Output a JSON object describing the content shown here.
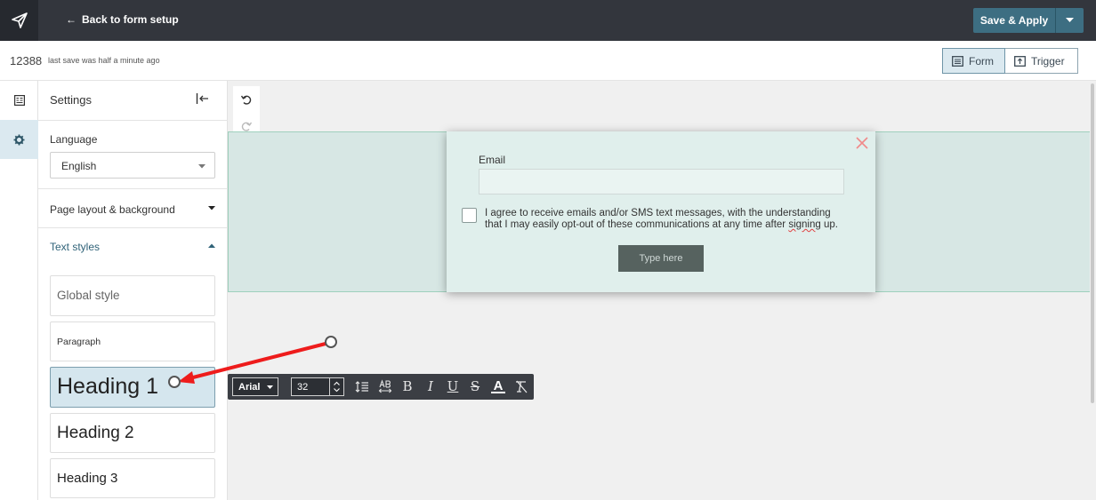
{
  "topbar": {
    "back_label": "Back to form setup",
    "save_label": "Save & Apply"
  },
  "subbar": {
    "form_id": "12388",
    "save_status": "last save was half a minute ago",
    "tabs": [
      {
        "label": "Form",
        "icon": "form-icon",
        "active": true
      },
      {
        "label": "Trigger",
        "icon": "trigger-icon",
        "active": false
      }
    ]
  },
  "rail": {
    "items": [
      {
        "icon": "form-list-icon",
        "active": false
      },
      {
        "icon": "gear-icon",
        "active": true
      }
    ]
  },
  "settings": {
    "title": "Settings",
    "language_label": "Language",
    "language_value": "English",
    "sections": [
      {
        "label": "Page layout & background",
        "expanded": false
      },
      {
        "label": "Text styles",
        "expanded": true
      }
    ],
    "text_styles": [
      {
        "label": "Global style",
        "selected": false
      },
      {
        "label": "Paragraph",
        "selected": false
      },
      {
        "label": "Heading 1",
        "selected": true
      },
      {
        "label": "Heading 2",
        "selected": false
      },
      {
        "label": "Heading 3",
        "selected": false
      }
    ]
  },
  "popup": {
    "email_label": "Email",
    "consent_before": "I agree to receive emails and/or SMS text messages, with the understanding that I may easily opt-out of these communications at any time after ",
    "consent_squiggle": "signing",
    "consent_after": " up.",
    "submit_label": "Type here"
  },
  "text_toolbar": {
    "font": "Arial",
    "size": "32",
    "icons": [
      "line-height-icon",
      "letter-spacing-icon",
      "bold-icon",
      "italic-icon",
      "underline-icon",
      "strikethrough-icon",
      "text-color-icon",
      "clear-format-icon"
    ]
  },
  "colors": {
    "accent": "#3d6e82",
    "topbar": "#33363d",
    "annotation_arrow": "#ee1c1c"
  }
}
